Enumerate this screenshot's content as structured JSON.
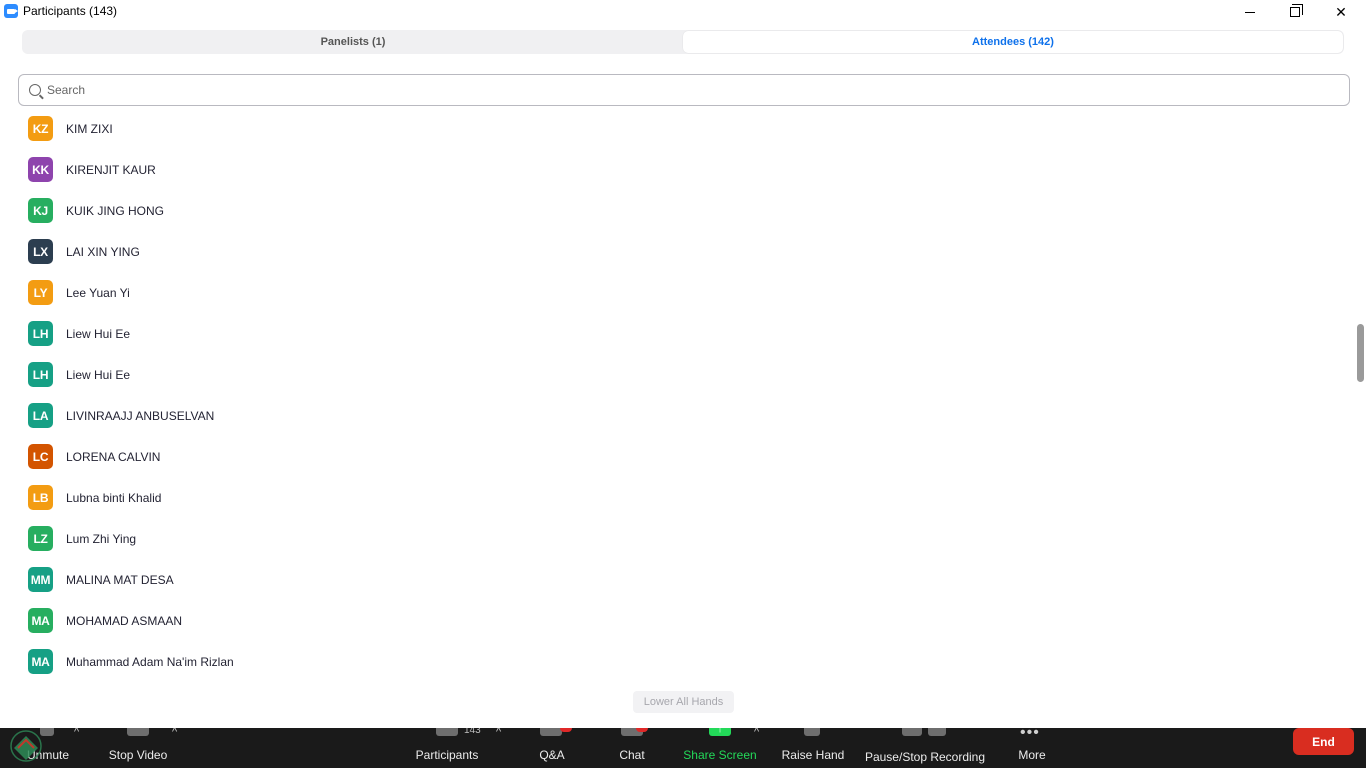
{
  "window": {
    "title": "Participants (143)"
  },
  "tabs": [
    {
      "label": "Panelists (1)",
      "active": false
    },
    {
      "label": "Attendees (142)",
      "active": true
    }
  ],
  "search": {
    "placeholder": "Search",
    "value": ""
  },
  "attendees": [
    {
      "initials": "KZ",
      "name": "KIM ZIXI",
      "color": "#f39c12"
    },
    {
      "initials": "KK",
      "name": "KIRENJIT KAUR",
      "color": "#8e44ad"
    },
    {
      "initials": "KJ",
      "name": "KUIK JING HONG",
      "color": "#27ae60"
    },
    {
      "initials": "LX",
      "name": "LAI XIN YING",
      "color": "#2c3e50"
    },
    {
      "initials": "LY",
      "name": "Lee Yuan Yi",
      "color": "#f39c12"
    },
    {
      "initials": "LH",
      "name": "Liew Hui Ee",
      "color": "#16a085"
    },
    {
      "initials": "LH",
      "name": "Liew Hui Ee",
      "color": "#16a085"
    },
    {
      "initials": "LA",
      "name": "LIVINRAAJJ ANBUSELVAN",
      "color": "#16a085"
    },
    {
      "initials": "LC",
      "name": "LORENA CALVIN",
      "color": "#d35400"
    },
    {
      "initials": "LB",
      "name": "Lubna binti Khalid",
      "color": "#f39c12"
    },
    {
      "initials": "LZ",
      "name": "Lum Zhi Ying",
      "color": "#27ae60"
    },
    {
      "initials": "MM",
      "name": "MALINA MAT DESA",
      "color": "#16a085"
    },
    {
      "initials": "MA",
      "name": "MOHAMAD ASMAAN",
      "color": "#27ae60"
    },
    {
      "initials": "MA",
      "name": "Muhammad Adam Na'im Rizlan",
      "color": "#16a085"
    }
  ],
  "lower_all_hands": "Lower All Hands",
  "toolbar": {
    "unmute": "Unmute",
    "stop_video": "Stop Video",
    "participants": "Participants",
    "participants_count": "143",
    "qa": "Q&A",
    "chat": "Chat",
    "share_screen": "Share Screen",
    "raise_hand": "Raise Hand",
    "recording": "Pause/Stop Recording",
    "more": "More",
    "end": "End"
  }
}
